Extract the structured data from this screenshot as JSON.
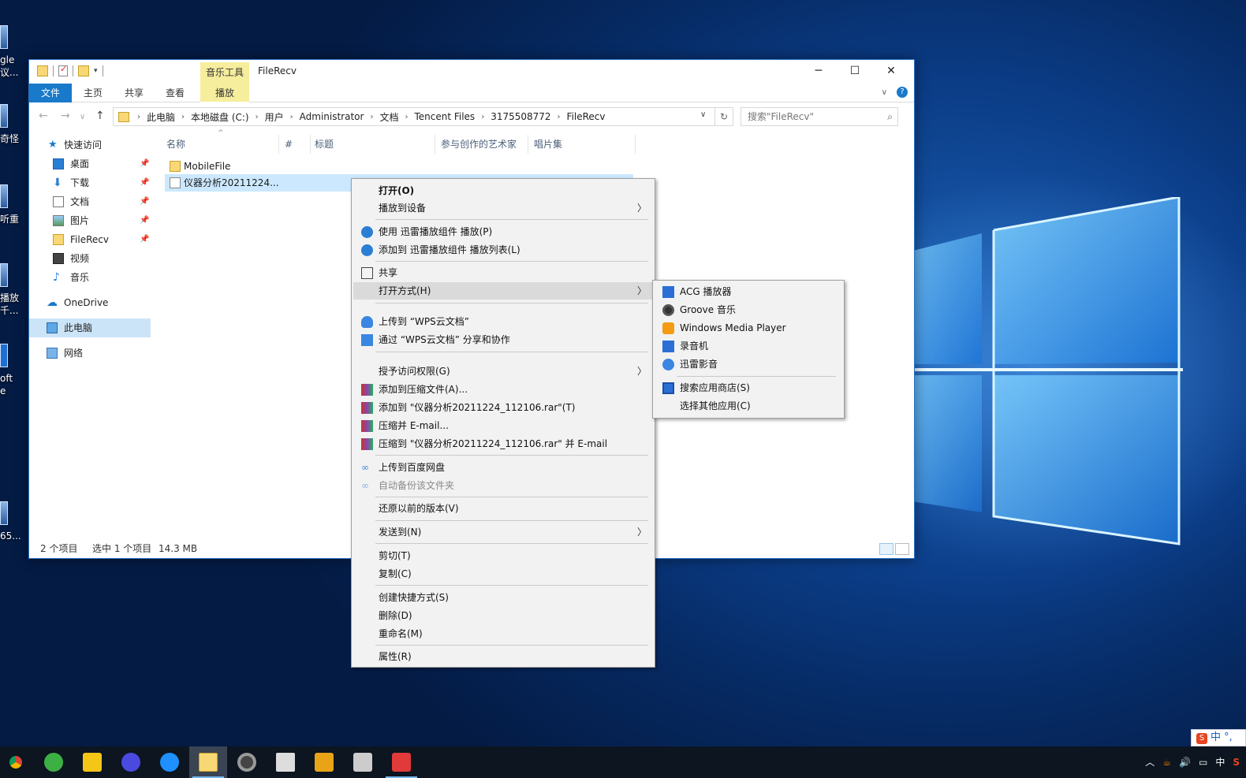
{
  "desktop": {
    "icons": [
      {
        "label": "gle\n议..."
      },
      {
        "label": "奇怪"
      },
      {
        "label": "听重"
      },
      {
        "label": "播放\n千..."
      },
      {
        "label": "oft\ne"
      },
      {
        "label": "65..."
      }
    ]
  },
  "window": {
    "title": "FileRecv",
    "tool_tab_header": "音乐工具",
    "ribbon_tabs": {
      "file": "文件",
      "home": "主页",
      "share": "共享",
      "view": "查看",
      "play": "播放"
    },
    "address": {
      "crumbs": [
        "此电脑",
        "本地磁盘 (C:)",
        "用户",
        "Administrator",
        "文档",
        "Tencent Files",
        "3175508772",
        "FileRecv"
      ]
    },
    "search_placeholder": "搜索\"FileRecv\"",
    "nav": {
      "quick_access": "快速访问",
      "desktop": "桌面",
      "downloads": "下载",
      "documents": "文档",
      "pictures": "图片",
      "filerecv": "FileRecv",
      "videos": "视频",
      "music": "音乐",
      "onedrive": "OneDrive",
      "this_pc": "此电脑",
      "network": "网络"
    },
    "columns": {
      "name": "名称",
      "number": "#",
      "title": "标题",
      "artist": "参与创作的艺术家",
      "album": "唱片集"
    },
    "files": [
      {
        "name": "MobileFile"
      },
      {
        "name": "仪器分析20211224..."
      }
    ],
    "status": {
      "count": "2 个项目",
      "selected": "选中 1 个项目",
      "size": "14.3 MB"
    }
  },
  "context_menu": {
    "open": "打开(O)",
    "cast": "播放到设备",
    "xl_play": "使用 迅雷播放组件 播放(P)",
    "xl_add": "添加到 迅雷播放组件 播放列表(L)",
    "share": "共享",
    "open_with": "打开方式(H)",
    "wps_upload": "上传到 “WPS云文档”",
    "wps_share": "通过 “WPS云文档” 分享和协作",
    "grant_access": "授予访问权限(G)",
    "rar_add": "添加到压缩文件(A)...",
    "rar_add_named": "添加到 \"仪器分析20211224_112106.rar\"(T)",
    "rar_email": "压缩并 E-mail...",
    "rar_named_email": "压缩到 \"仪器分析20211224_112106.rar\" 并 E-mail",
    "baidu_upload": "上传到百度网盘",
    "baidu_backup": "自动备份该文件夹",
    "restore": "还原以前的版本(V)",
    "send_to": "发送到(N)",
    "cut": "剪切(T)",
    "copy": "复制(C)",
    "shortcut": "创建快捷方式(S)",
    "delete": "删除(D)",
    "rename": "重命名(M)",
    "properties": "属性(R)"
  },
  "open_with_menu": {
    "acg": "ACG 播放器",
    "groove": "Groove 音乐",
    "wmp": "Windows Media Player",
    "recorder": "录音机",
    "xunlei": "迅雷影音",
    "store": "搜索应用商店(S)",
    "other": "选择其他应用(C)"
  },
  "taskbar": {
    "tray_ime": "中",
    "ime_bar": "中 °,"
  },
  "colors": {
    "accent": "#1979ca",
    "selection": "#cce8ff",
    "tool_tab": "#f6ee9d"
  }
}
